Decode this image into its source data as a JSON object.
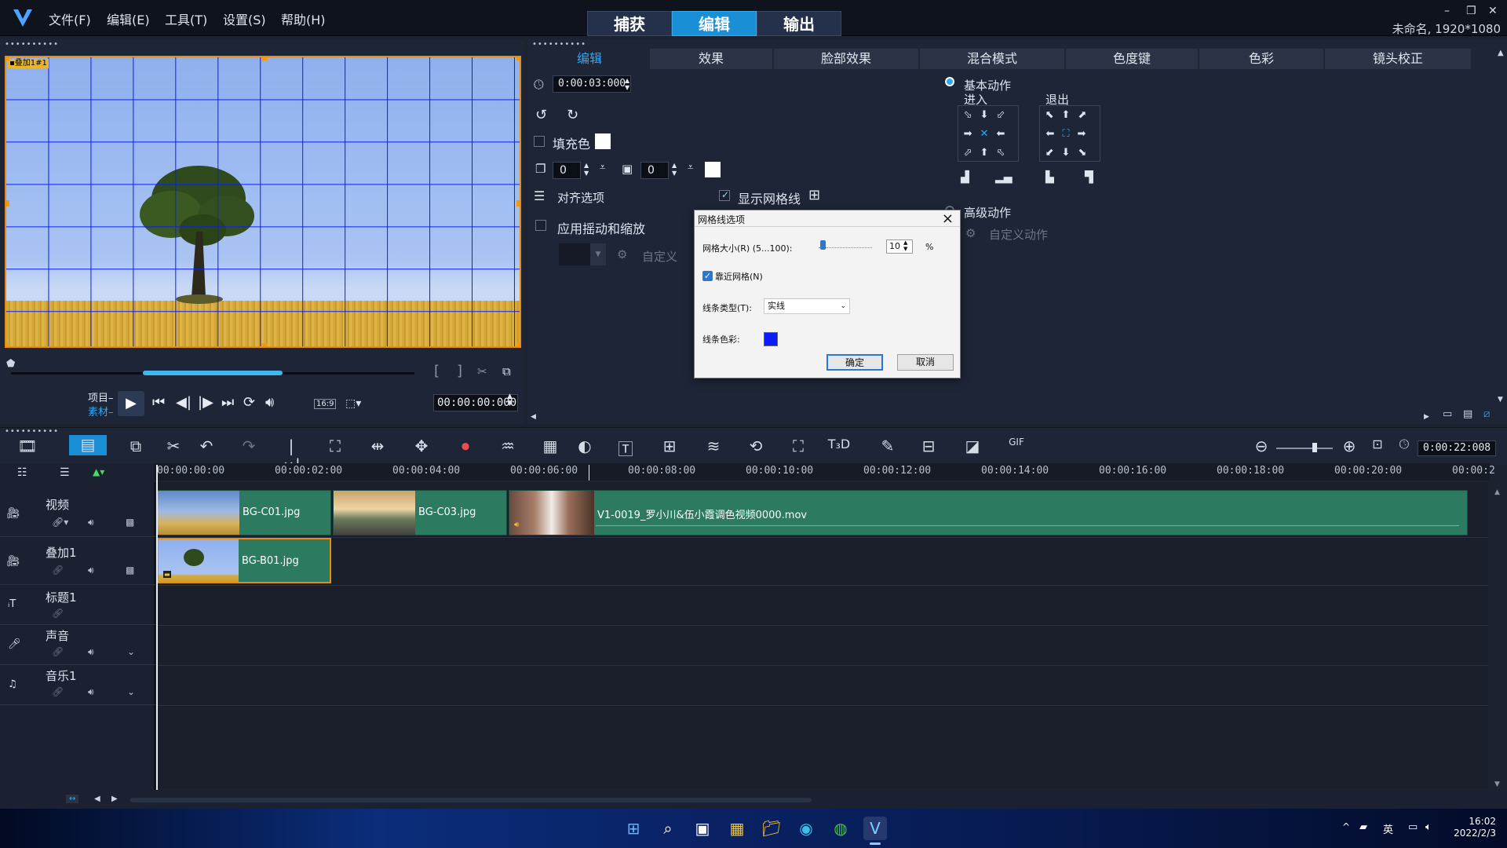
{
  "menu": [
    "文件(F)",
    "编辑(E)",
    "工具(T)",
    "设置(S)",
    "帮助(H)"
  ],
  "modes": [
    "捕获",
    "编辑",
    "输出"
  ],
  "active_mode": "编辑",
  "project_info": "未命名, 1920*1080",
  "preview": {
    "overlay_label": "叠加1",
    "project_label": "项目",
    "clip_label": "素材",
    "timecode": "00:00:00:000",
    "aspect_ratio": "16:9"
  },
  "options": {
    "tabs": [
      "编辑",
      "效果",
      "脸部效果",
      "混合模式",
      "色度键",
      "色彩",
      "镜头校正"
    ],
    "active_tab": "编辑",
    "duration": "0:00:03:000",
    "fill_color_label": "填充色",
    "border_value_1": "0",
    "border_value_2": "0",
    "align_options_label": "对齐选项",
    "show_grid_label": "显示网格线",
    "pan_zoom_label": "应用摇动和缩放",
    "custom_label": "自定义",
    "basic_motion_label": "基本动作",
    "enter_label": "进入",
    "exit_label": "退出",
    "advanced_motion_label": "高级动作",
    "custom_motion_label": "自定义动作"
  },
  "dialog": {
    "title": "网格线选项",
    "grid_size_label": "网格大小(R) (5...100):",
    "grid_size_value": "10",
    "grid_size_unit": "%",
    "snap_label": "靠近网格(N)",
    "line_type_label": "线条类型(T):",
    "line_type_value": "实线",
    "line_color_label": "线条色彩:",
    "line_color": "#0b1cff",
    "ok_label": "确定",
    "cancel_label": "取消"
  },
  "timeline": {
    "zoom_timecode": "0:00:22:008",
    "ruler_ticks": [
      "00:00:00:00",
      "00:00:02:00",
      "00:00:04:00",
      "00:00:06:00",
      "00:00:08:00",
      "00:00:10:00",
      "00:00:12:00",
      "00:00:14:00",
      "00:00:16:00",
      "00:00:18:00",
      "00:00:20:00",
      "00:00:2"
    ],
    "tracks": [
      "视频",
      "叠加1",
      "标题1",
      "声音",
      "音乐1"
    ],
    "clips": {
      "video1": "BG-C01.jpg",
      "video2": "BG-C03.jpg",
      "video3": "V1-0019_罗小川&伍小霞调色视频0000.mov",
      "overlay1": "BG-B01.jpg"
    }
  },
  "taskbar": {
    "tray_lang": "英",
    "time": "16:02",
    "date": "2022/2/3"
  },
  "colors": {
    "accent": "#1a8fd6",
    "grid_line": "#0b1cff",
    "selection_border": "#e88d12",
    "clip_fill": "#2c7a5f"
  }
}
